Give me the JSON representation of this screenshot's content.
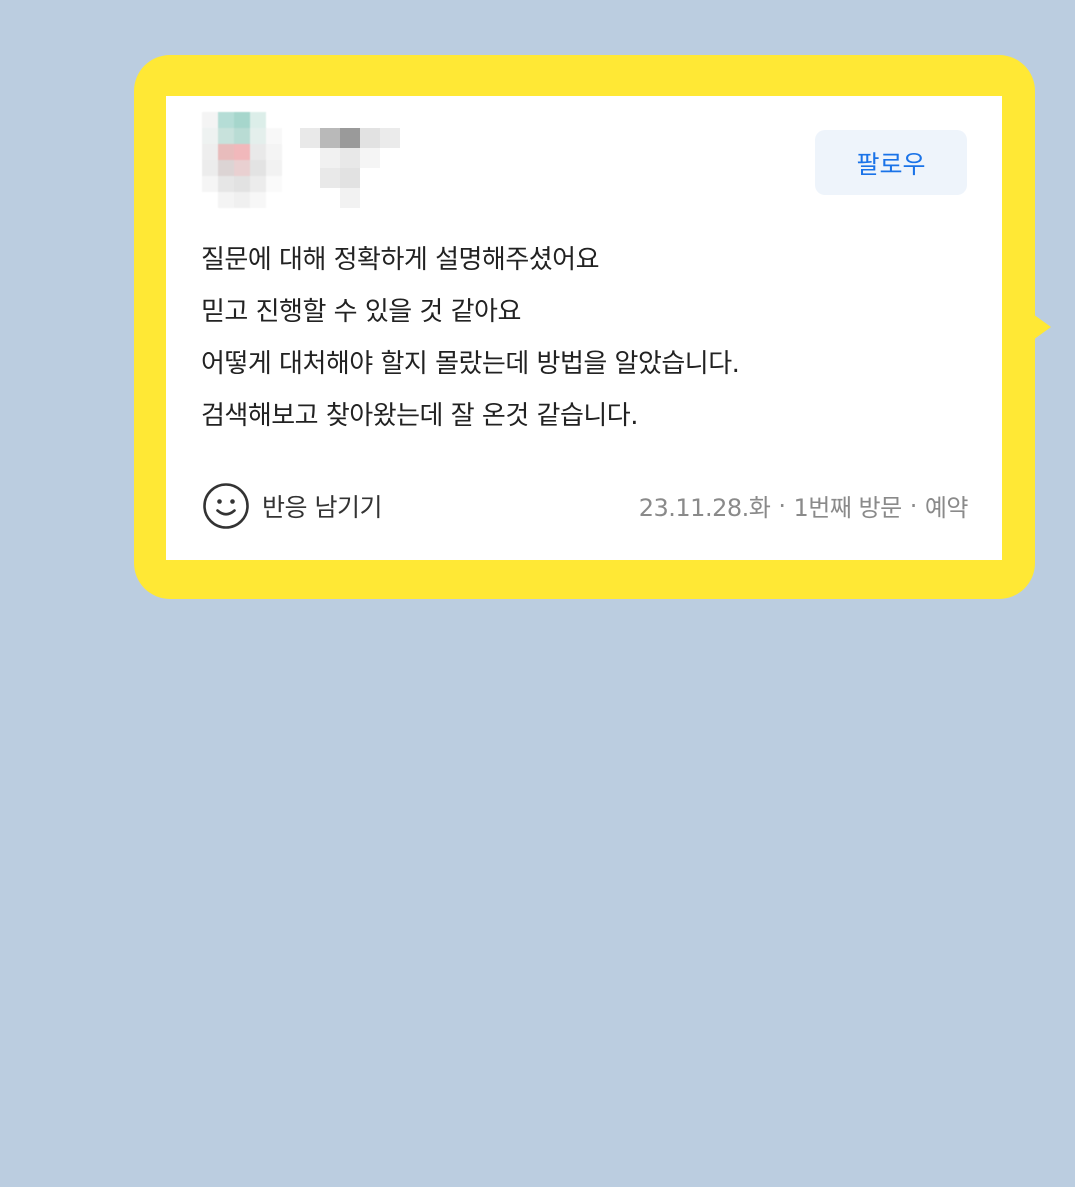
{
  "colors": {
    "background": "#bbcde0",
    "bubble": "#ffe835",
    "card": "#ffffff",
    "follow_text": "#1a73e8",
    "follow_bg": "#eef4fb",
    "review_text": "#222222",
    "meta_text": "#8a8a8a"
  },
  "review": {
    "follow_label": "팔로우",
    "lines": [
      "질문에 대해 정확하게 설명해주셨어요",
      "믿고 진행할 수 있을 것 같아요",
      "어떻게 대처해야 할지 몰랐는데 방법을 알았습니다.",
      "검색해보고 찾아왔는데 잘 온것 같습니다."
    ],
    "react_label": "반응 남기기",
    "react_icon": "smile-icon",
    "date": "23.11.28.화",
    "visit": "1번째 방문",
    "type": "예약",
    "separator": "·"
  }
}
